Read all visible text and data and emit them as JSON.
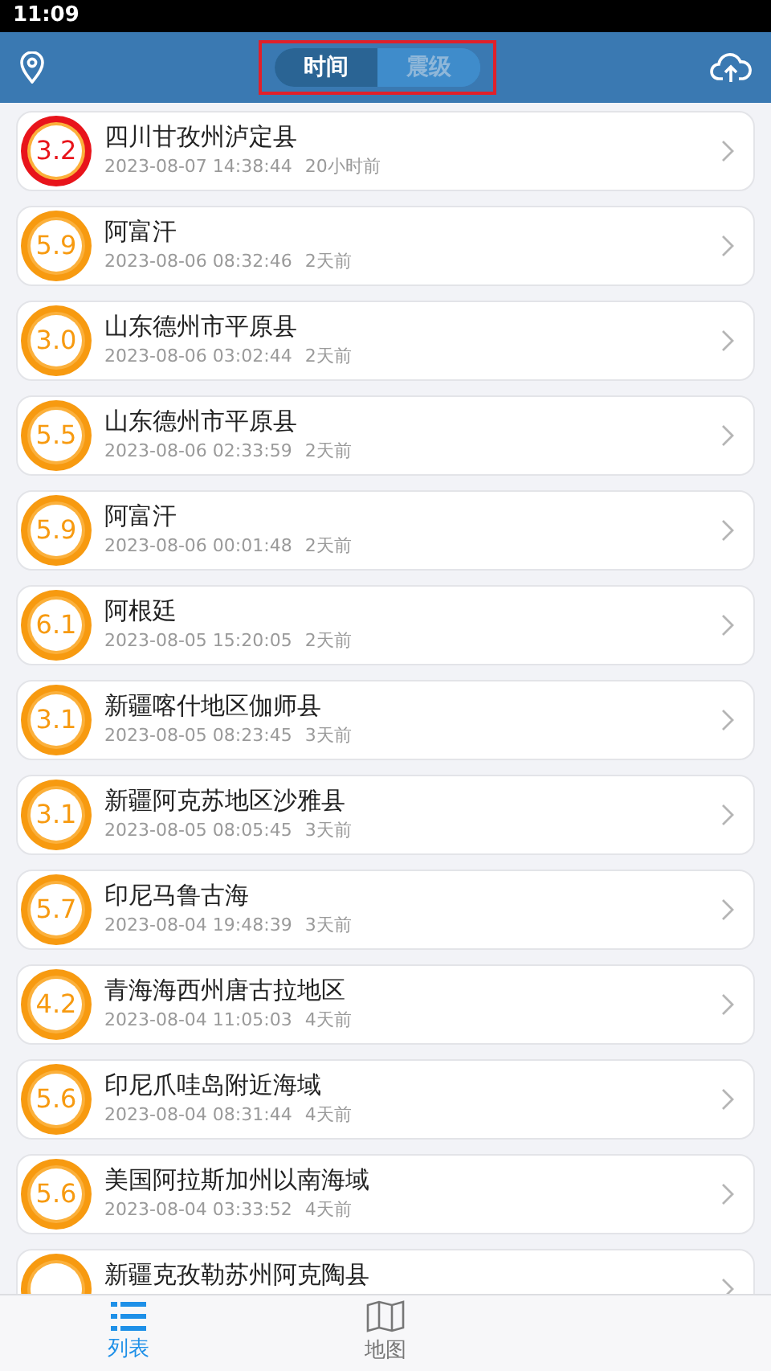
{
  "status_bar": {
    "time": "11:09"
  },
  "header": {
    "segments": [
      {
        "label": "时间",
        "selected": true
      },
      {
        "label": "震级",
        "selected": false
      }
    ]
  },
  "quakes": [
    {
      "magnitude": "3.2",
      "color": "#e8141b",
      "place": "四川甘孜州泸定县",
      "time": "2023-08-07 14:38:44",
      "ago": "20小时前"
    },
    {
      "magnitude": "5.9",
      "color": "#f79a10",
      "place": "阿富汗",
      "time": "2023-08-06 08:32:46",
      "ago": "2天前"
    },
    {
      "magnitude": "3.0",
      "color": "#f79a10",
      "place": "山东德州市平原县",
      "time": "2023-08-06 03:02:44",
      "ago": "2天前"
    },
    {
      "magnitude": "5.5",
      "color": "#f79a10",
      "place": "山东德州市平原县",
      "time": "2023-08-06 02:33:59",
      "ago": "2天前"
    },
    {
      "magnitude": "5.9",
      "color": "#f79a10",
      "place": "阿富汗",
      "time": "2023-08-06 00:01:48",
      "ago": "2天前"
    },
    {
      "magnitude": "6.1",
      "color": "#f79a10",
      "place": "阿根廷",
      "time": "2023-08-05 15:20:05",
      "ago": "2天前"
    },
    {
      "magnitude": "3.1",
      "color": "#f79a10",
      "place": "新疆喀什地区伽师县",
      "time": "2023-08-05 08:23:45",
      "ago": "3天前"
    },
    {
      "magnitude": "3.1",
      "color": "#f79a10",
      "place": "新疆阿克苏地区沙雅县",
      "time": "2023-08-05 08:05:45",
      "ago": "3天前"
    },
    {
      "magnitude": "5.7",
      "color": "#f79a10",
      "place": "印尼马鲁古海",
      "time": "2023-08-04 19:48:39",
      "ago": "3天前"
    },
    {
      "magnitude": "4.2",
      "color": "#f79a10",
      "place": "青海海西州唐古拉地区",
      "time": "2023-08-04 11:05:03",
      "ago": "4天前"
    },
    {
      "magnitude": "5.6",
      "color": "#f79a10",
      "place": "印尼爪哇岛附近海域",
      "time": "2023-08-04 08:31:44",
      "ago": "4天前"
    },
    {
      "magnitude": "5.6",
      "color": "#f79a10",
      "place": "美国阿拉斯加州以南海域",
      "time": "2023-08-04 03:33:52",
      "ago": "4天前"
    },
    {
      "color": "#f79a10",
      "place": "新疆克孜勒苏州阿克陶县"
    }
  ],
  "tab_bar": [
    {
      "label": "列表",
      "kind": "list",
      "selected": true
    },
    {
      "label": "地图",
      "kind": "map",
      "selected": false
    }
  ]
}
